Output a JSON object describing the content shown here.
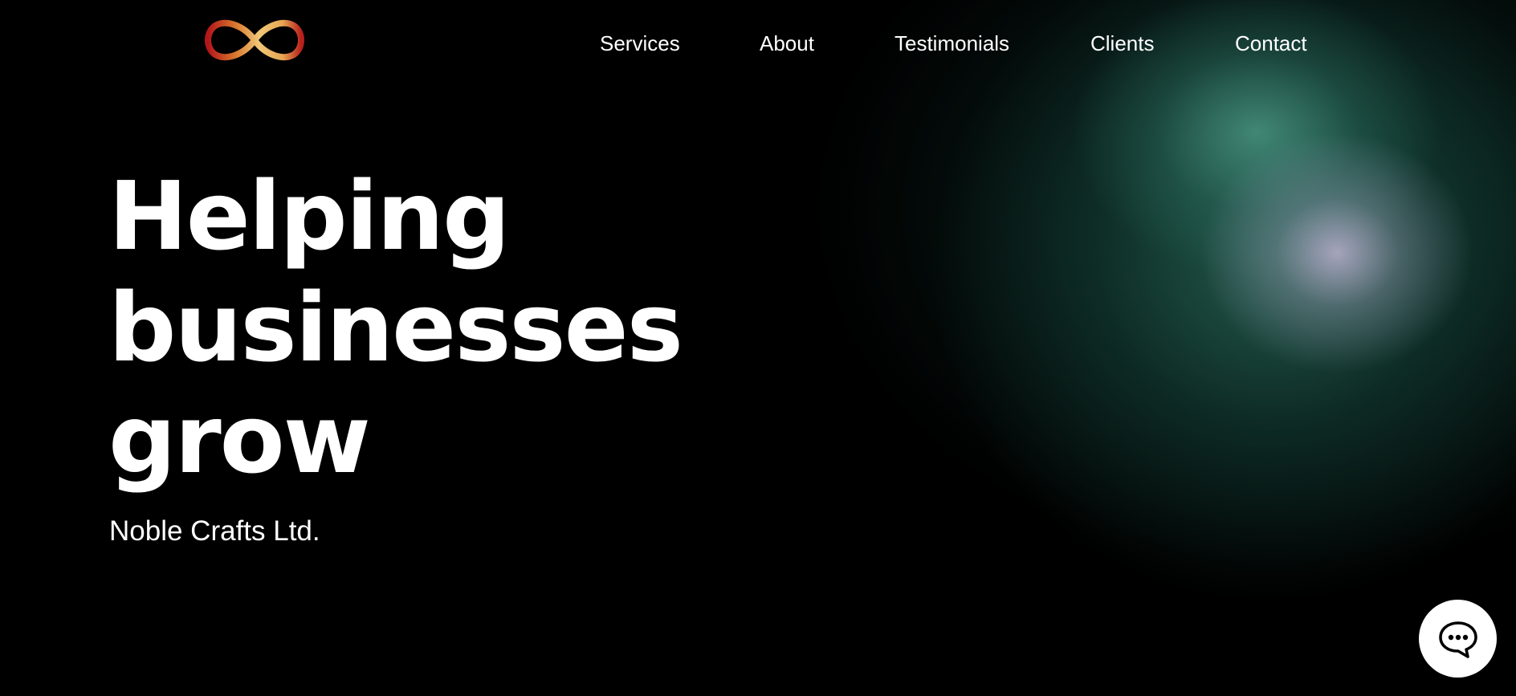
{
  "brand": {
    "logo_icon": "infinity-logo-icon"
  },
  "nav": {
    "items": [
      {
        "label": "Services"
      },
      {
        "label": "About"
      },
      {
        "label": "Testimonials"
      },
      {
        "label": "Clients"
      },
      {
        "label": "Contact"
      }
    ]
  },
  "hero": {
    "headline_lines": [
      "Helping",
      "businesses",
      "grow"
    ],
    "company": "Noble Crafts Ltd."
  },
  "chat": {
    "icon": "chat-bubble-icon"
  },
  "colors": {
    "background": "#000000",
    "text": "#ffffff",
    "glow_green": "#2f7a68",
    "glow_lavender": "#b9b3cf",
    "logo_gold": "#e8b860",
    "logo_red": "#b8201c"
  }
}
